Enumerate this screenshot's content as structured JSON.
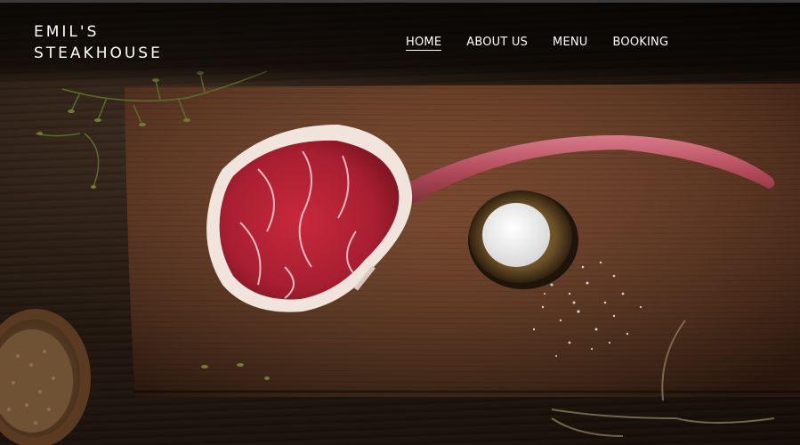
{
  "brand": {
    "line1": "EMIL'S",
    "line2": "STEAKHOUSE"
  },
  "nav": {
    "items": [
      {
        "label": "HOME",
        "active": true
      },
      {
        "label": "ABOUT US",
        "active": false
      },
      {
        "label": "MENU",
        "active": false
      },
      {
        "label": "BOOKING",
        "active": false
      }
    ]
  },
  "hero": {
    "image": "tomahawk-steak-on-cutting-board"
  },
  "colors": {
    "header_text": "#ffffff",
    "wood_dark": "#1a120c",
    "board": "#5a3522",
    "meat": "#b8273a",
    "salt": "#f2f2f2"
  }
}
